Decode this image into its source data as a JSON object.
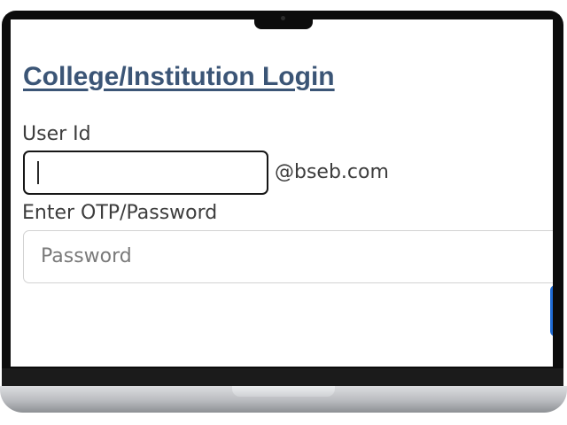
{
  "login": {
    "title": "College/Institution Login",
    "user_id_label": "User Id",
    "user_id_value": "",
    "user_id_suffix": "@bseb.com",
    "password_label": "Enter OTP/Password",
    "password_placeholder": "Password"
  },
  "colors": {
    "title": "#3b5576",
    "text": "#3d3d3d",
    "button": "#1f6bd4",
    "laptop_bezel": "#0c0c0c"
  }
}
